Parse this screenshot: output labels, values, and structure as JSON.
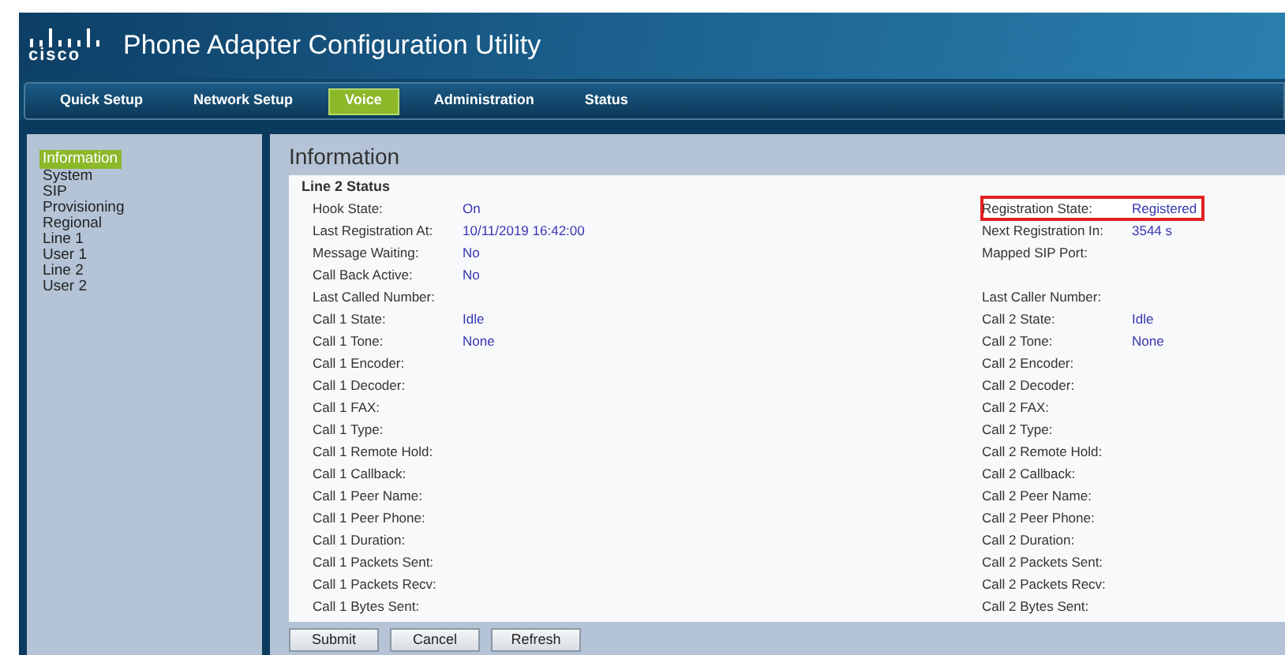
{
  "header": {
    "logo_text": "cisco",
    "title": "Phone Adapter Configuration Utility"
  },
  "tabs": [
    {
      "label": "Quick Setup",
      "selected": false
    },
    {
      "label": "Network Setup",
      "selected": false
    },
    {
      "label": "Voice",
      "selected": true
    },
    {
      "label": "Administration",
      "selected": false
    },
    {
      "label": "Status",
      "selected": false
    }
  ],
  "sidebar": {
    "items": [
      {
        "label": "Information",
        "selected": true
      },
      {
        "label": "System",
        "selected": false
      },
      {
        "label": "SIP",
        "selected": false
      },
      {
        "label": "Provisioning",
        "selected": false
      },
      {
        "label": "Regional",
        "selected": false
      },
      {
        "label": "Line 1",
        "selected": false
      },
      {
        "label": "User 1",
        "selected": false
      },
      {
        "label": "Line 2",
        "selected": false
      },
      {
        "label": "User 2",
        "selected": false
      }
    ]
  },
  "page_title": "Information",
  "section_title": "Line 2 Status",
  "rows": [
    {
      "left": {
        "label": "Hook State:",
        "value": "On"
      },
      "right": {
        "label": "Registration State:",
        "value": "Registered",
        "highlighted": true
      }
    },
    {
      "left": {
        "label": "Last Registration At:",
        "value": "10/11/2019 16:42:00"
      },
      "right": {
        "label": "Next Registration In:",
        "value": "3544 s",
        "highlighted": false
      }
    },
    {
      "left": {
        "label": "Message Waiting:",
        "value": "No"
      },
      "right": {
        "label": "Mapped SIP Port:",
        "highlighted": false
      }
    },
    {
      "left": {
        "label": "Call Back Active:",
        "value": "No"
      }
    },
    {
      "left": {
        "label": "Last Called Number:"
      },
      "right": {
        "label": "Last Caller Number:",
        "highlighted": false
      }
    },
    {
      "left": {
        "label": "Call 1 State:",
        "value": "Idle"
      },
      "right": {
        "label": "Call 2 State:",
        "value": "Idle",
        "highlighted": false
      }
    },
    {
      "left": {
        "label": "Call 1 Tone:",
        "value": "None"
      },
      "right": {
        "label": "Call 2 Tone:",
        "value": "None",
        "highlighted": false
      }
    },
    {
      "left": {
        "label": "Call 1 Encoder:"
      },
      "right": {
        "label": "Call 2 Encoder:",
        "highlighted": false
      }
    },
    {
      "left": {
        "label": "Call 1 Decoder:"
      },
      "right": {
        "label": "Call 2 Decoder:",
        "highlighted": false
      }
    },
    {
      "left": {
        "label": "Call 1 FAX:"
      },
      "right": {
        "label": "Call 2 FAX:",
        "highlighted": false
      }
    },
    {
      "left": {
        "label": "Call 1 Type:"
      },
      "right": {
        "label": "Call 2 Type:",
        "highlighted": false
      }
    },
    {
      "left": {
        "label": "Call 1 Remote Hold:"
      },
      "right": {
        "label": "Call 2 Remote Hold:",
        "highlighted": false
      }
    },
    {
      "left": {
        "label": "Call 1 Callback:"
      },
      "right": {
        "label": "Call 2 Callback:",
        "highlighted": false
      }
    },
    {
      "left": {
        "label": "Call 1 Peer Name:"
      },
      "right": {
        "label": "Call 2 Peer Name:",
        "highlighted": false
      }
    },
    {
      "left": {
        "label": "Call 1 Peer Phone:"
      },
      "right": {
        "label": "Call 2 Peer Phone:",
        "highlighted": false
      }
    },
    {
      "left": {
        "label": "Call 1 Duration:"
      },
      "right": {
        "label": "Call 2 Duration:",
        "highlighted": false
      }
    },
    {
      "left": {
        "label": "Call 1 Packets Sent:"
      },
      "right": {
        "label": "Call 2 Packets Sent:",
        "highlighted": false
      }
    },
    {
      "left": {
        "label": "Call 1 Packets Recv:"
      },
      "right": {
        "label": "Call 2 Packets Recv:",
        "highlighted": false
      }
    },
    {
      "left": {
        "label": "Call 1 Bytes Sent:"
      },
      "right": {
        "label": "Call 2 Bytes Sent:",
        "highlighted": false
      }
    }
  ],
  "buttons": [
    "Submit",
    "Cancel",
    "Refresh"
  ]
}
